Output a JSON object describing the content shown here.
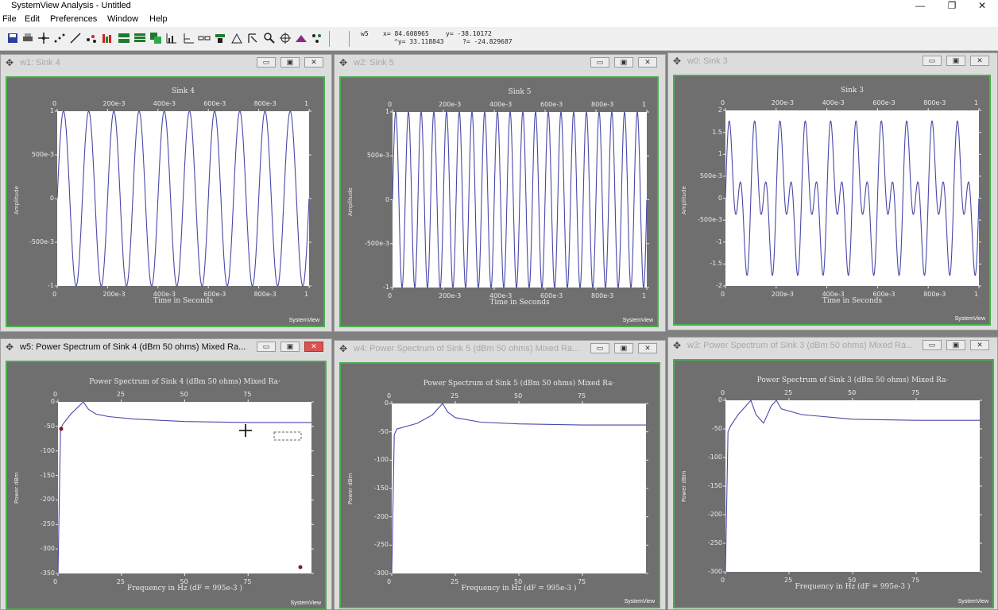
{
  "app": {
    "title": "SystemView Analysis - Untitled",
    "controls": {
      "minimize": "—",
      "restore": "❐",
      "close": "✕"
    }
  },
  "menu": [
    "File",
    "Edit",
    "Preferences",
    "Window",
    "Help"
  ],
  "toolbar": {
    "icons": [
      "save-icon",
      "print-icon",
      "move-icon",
      "points-icon",
      "line-icon",
      "scatter-icon",
      "bars-icon",
      "tile-h-icon",
      "tile-v-icon",
      "cascade-icon",
      "stats-icon",
      "axes-icon",
      "link-icon",
      "stack-icon",
      "triangle-icon",
      "cursor-icon",
      "zoom-icon",
      "crosshair-icon",
      "mountain-icon",
      "dots-icon"
    ],
    "readout": {
      "win": "w5",
      "x": "x= 84.608965",
      "y": "y= -38.10172",
      "x2": "^y= 33.118843",
      "y2": "?= -24.829687"
    }
  },
  "accent": "#48b04a",
  "trace_color": "#4848a8",
  "windows": [
    {
      "id": "w1",
      "title": "w1: Sink 4",
      "active": false,
      "plot": {
        "title": "Sink 4",
        "xlabel": "Time in Seconds",
        "ylabel": "Amplitude",
        "xticks": [
          "0",
          "200e-3",
          "400e-3",
          "600e-3",
          "800e-3",
          "1"
        ],
        "yticks": [
          "1",
          "500e-3",
          "0",
          "-500e-3",
          "-1"
        ],
        "brand": "SystemView"
      }
    },
    {
      "id": "w2",
      "title": "w2: Sink 5",
      "active": false,
      "plot": {
        "title": "Sink 5",
        "xlabel": "Time in Seconds",
        "ylabel": "Amplitude",
        "xticks": [
          "0",
          "200e-3",
          "400e-3",
          "600e-3",
          "800e-3",
          "1"
        ],
        "yticks": [
          "1",
          "500e-3",
          "0",
          "-500e-3",
          "-1"
        ],
        "brand": "SystemView"
      }
    },
    {
      "id": "w0",
      "title": "w0: Sink 3",
      "active": false,
      "plot": {
        "title": "Sink 3",
        "xlabel": "Time in Seconds",
        "ylabel": "Amplitude",
        "xticks": [
          "0",
          "200e-3",
          "400e-3",
          "600e-3",
          "800e-3",
          "1"
        ],
        "yticks": [
          "2",
          "1.5",
          "1",
          "500e-3",
          "0",
          "-500e-3",
          "-1",
          "-1.5",
          "-2"
        ],
        "brand": "SystemView"
      }
    },
    {
      "id": "w5",
      "title": "w5: Power Spectrum of Sink 4 (dBm 50 ohms) Mixed Ra...",
      "active": true,
      "plot": {
        "title": "Power Spectrum of Sink 4 (dBm 50 ohms) Mixed Ra·",
        "xlabel": "Frequency in Hz (dF = 995e-3 )",
        "ylabel": "Power dBm",
        "xticks": [
          "0",
          "25",
          "50",
          "75"
        ],
        "yticks": [
          "0",
          "-50",
          "-100",
          "-150",
          "-200",
          "-250",
          "-300",
          "-350"
        ],
        "brand": "SystemView"
      }
    },
    {
      "id": "w4",
      "title": "w4: Power Spectrum of Sink 5 (dBm 50 ohms) Mixed Ra...",
      "active": false,
      "plot": {
        "title": "Power Spectrum of Sink 5 (dBm 50 ohms) Mixed Ra·",
        "xlabel": "Frequency in Hz (dF = 995e-3 )",
        "ylabel": "Power dBm",
        "xticks": [
          "0",
          "25",
          "50",
          "75"
        ],
        "yticks": [
          "0",
          "-50",
          "-100",
          "-150",
          "-200",
          "-250",
          "-300"
        ],
        "brand": "SystemView"
      }
    },
    {
      "id": "w3",
      "title": "w3: Power Spectrum of Sink 3 (dBm 50 ohms) Mixed Ra...",
      "active": false,
      "plot": {
        "title": "Power Spectrum of Sink 3 (dBm 50 ohms) Mixed Ra·",
        "xlabel": "Frequency in Hz (dF = 995e-3 )",
        "ylabel": "Power dBm",
        "xticks": [
          "0",
          "25",
          "50",
          "75"
        ],
        "yticks": [
          "0",
          "-50",
          "-100",
          "-150",
          "-200",
          "-250",
          "-300"
        ],
        "brand": "SystemView"
      }
    }
  ],
  "chart_data": [
    {
      "type": "line",
      "title": "Sink 4",
      "xlabel": "Time in Seconds",
      "ylabel": "Amplitude",
      "xlim": [
        0,
        1
      ],
      "ylim": [
        -1,
        1
      ],
      "series": [
        {
          "function": "sin",
          "frequency_hz": 10,
          "amplitude": 1
        }
      ]
    },
    {
      "type": "line",
      "title": "Sink 5",
      "xlabel": "Time in Seconds",
      "ylabel": "Amplitude",
      "xlim": [
        0,
        1
      ],
      "ylim": [
        -1,
        1
      ],
      "series": [
        {
          "function": "sin",
          "frequency_hz": 20,
          "amplitude": 1
        }
      ]
    },
    {
      "type": "line",
      "title": "Sink 3",
      "xlabel": "Time in Seconds",
      "ylabel": "Amplitude",
      "xlim": [
        0,
        1
      ],
      "ylim": [
        -2,
        2
      ],
      "series": [
        {
          "function": "sum_of_sines",
          "frequencies_hz": [
            10,
            20
          ],
          "amplitudes": [
            1,
            1
          ]
        }
      ]
    },
    {
      "type": "line",
      "title": "Power Spectrum of Sink 4 (dBm 50 ohms) Mixed Ra·",
      "xlabel": "Frequency in Hz (dF = 995e-3 )",
      "ylabel": "Power dBm",
      "xlim": [
        0,
        100
      ],
      "ylim": [
        -350,
        0
      ],
      "series": [
        {
          "x": [
            0,
            1,
            2,
            5,
            8,
            10,
            12,
            15,
            20,
            30,
            50,
            75,
            100
          ],
          "y": [
            -350,
            -55,
            -45,
            -25,
            -10,
            10,
            -15,
            -25,
            -30,
            -35,
            -40,
            -42,
            -42
          ]
        }
      ]
    },
    {
      "type": "line",
      "title": "Power Spectrum of Sink 5 (dBm 50 ohms) Mixed Ra·",
      "xlabel": "Frequency in Hz (dF = 995e-3 )",
      "ylabel": "Power dBm",
      "xlim": [
        0,
        100
      ],
      "ylim": [
        -300,
        0
      ],
      "series": [
        {
          "x": [
            0,
            1,
            2,
            10,
            16,
            18,
            20,
            22,
            25,
            35,
            50,
            75,
            100
          ],
          "y": [
            -300,
            -55,
            -45,
            -35,
            -20,
            -10,
            5,
            -15,
            -25,
            -33,
            -36,
            -38,
            -38
          ]
        }
      ]
    },
    {
      "type": "line",
      "title": "Power Spectrum of Sink 3 (dBm 50 ohms) Mixed Ra·",
      "xlabel": "Frequency in Hz (dF = 995e-3 )",
      "ylabel": "Power dBm",
      "xlim": [
        0,
        100
      ],
      "ylim": [
        -300,
        0
      ],
      "series": [
        {
          "x": [
            0,
            1,
            2,
            5,
            8,
            10,
            12,
            15,
            18,
            20,
            22,
            30,
            50,
            75,
            100
          ],
          "y": [
            -300,
            -55,
            -45,
            -25,
            -10,
            5,
            -25,
            -40,
            -10,
            8,
            -15,
            -25,
            -33,
            -35,
            -35
          ]
        }
      ]
    }
  ]
}
